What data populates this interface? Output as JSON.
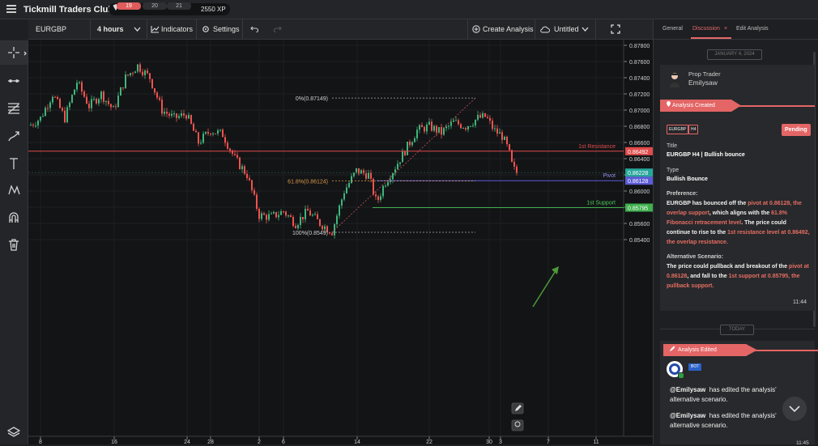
{
  "app": {
    "title": "Tickmill Traders Club",
    "levels": [
      "19",
      "20",
      "21"
    ],
    "xp": "2550 XP"
  },
  "toolbar": {
    "symbol": "EURGBP",
    "interval": "4 hours",
    "indicators": "Indicators",
    "settings": "Settings",
    "create_analysis": "Create Analysis",
    "untitled": "Untitled"
  },
  "chart": {
    "price_labels": [
      "0.87800",
      "0.87600",
      "0.87400",
      "0.87200",
      "0.87000",
      "0.86800",
      "0.86600",
      "0.86400",
      "0.86200",
      "0.86000",
      "0.85800",
      "0.85600",
      "0.85400"
    ],
    "date_labels": [
      "8",
      "16",
      "24",
      "28",
      "2",
      "6",
      "14",
      "22",
      "30",
      "3",
      "7",
      "11"
    ],
    "resistance": {
      "label": "1st Resistance",
      "price": "0.86492"
    },
    "pivot": {
      "label": "Pivot",
      "price": "0.86128"
    },
    "current": {
      "price": "0.86228"
    },
    "support": {
      "label": "1st Support",
      "price": "0.85795"
    },
    "fib": {
      "top": "0%(0.87149)",
      "mid": "61.8%(0.86124)",
      "bottom": "100%(0.8549)"
    },
    "colors": {
      "up": "#3fb57c",
      "down": "#ef5350",
      "resistance": "#e04b4b",
      "pivot": "#5b5bd6",
      "support": "#3fb04e",
      "fib": "#d89a4a",
      "arrow": "#4e9a3a"
    }
  },
  "panel": {
    "tabs": [
      "General",
      "Discussion",
      "Edit Analysis"
    ],
    "tab_close": "×",
    "date1": "JANUARY 4, 2024",
    "author_role": "Prop Trader",
    "author_name": "Emilysaw",
    "created_label": "Analysis Created",
    "symbol_badge": "EURGBP",
    "tf_badge": "H4",
    "status": "Pending",
    "title_label": "Title",
    "title_value": "EURGBP H4 | Bullish bounce",
    "type_label": "Type",
    "type_value": "Bullish Bounce",
    "pref_label": "Preference:",
    "pref_1": "EURGBP has bounced off the ",
    "pref_2": "pivot at 0.86128, the overlap support",
    "pref_3": ", which aligns with the ",
    "pref_4": "61.8% Fibonacci retracement level",
    "pref_5": ". The price could continue to rise to the ",
    "pref_6": "1st resistance level at 0.86492, the overlap resistance.",
    "alt_label": "Alternative Scenario:",
    "alt_1": "The price could pullback and breakout of the ",
    "alt_2": "pivot at 0.86128",
    "alt_3": ", and fall to the ",
    "alt_4": "1st support at 0.85795, the pullback support.",
    "time1": "11:44",
    "date2": "TODAY",
    "edited_label": "Analysis Edited",
    "bot_badge": "BOT",
    "msg1_user": "@Emilysaw",
    "msg1_text": "has edited the analysis' alternative scenario.",
    "msg2_user": "@Emilysaw",
    "msg2_text": "has edited the analysis' alternative scenario.",
    "time2": "11:45"
  }
}
